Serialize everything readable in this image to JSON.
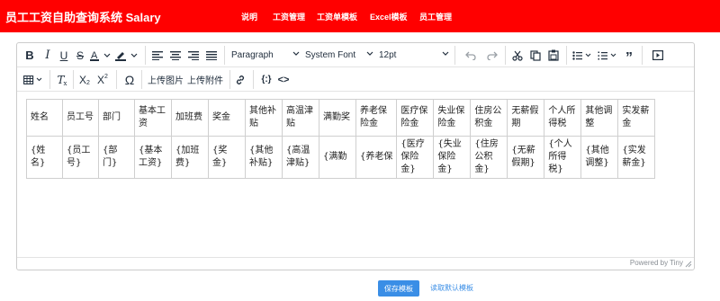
{
  "header": {
    "brand": "员工工资自助查询系统 Salary",
    "nav": [
      {
        "label": "说明"
      },
      {
        "label": "工资管理"
      },
      {
        "label": "工资单模板"
      },
      {
        "label": "Excel模板"
      },
      {
        "label": "员工管理"
      }
    ]
  },
  "toolbar": {
    "block_format": "Paragraph",
    "font_family": "System Font",
    "font_size": "12pt",
    "upload_image": "上传图片",
    "upload_attachment": "上传附件"
  },
  "table": {
    "headers": [
      "姓名",
      "员工号",
      "部门",
      "基本工资",
      "加班费",
      "奖金",
      "其他补贴",
      "高温津贴",
      "满勤奖",
      "养老保险金",
      "医疗保险金",
      "失业保险金",
      "住房公积金",
      "无薪假期",
      "个人所得税",
      "其他调整",
      "实发薪金"
    ],
    "cells": [
      "{姓名}",
      "{员工号}",
      "{部门}",
      "{基本工资}",
      "{加班费}",
      "{奖金}",
      "{其他补贴}",
      "{高温津贴}",
      "{满勤",
      "{养老保",
      "{医疗保险金}",
      "{失业保险金}",
      "{住房公积金}",
      "{无薪假期}",
      "{个人所得税}",
      "{其他调整}",
      "{实发薪金}"
    ]
  },
  "statusbar": {
    "powered_by": "Powered by Tiny"
  },
  "actions": {
    "save_label": "保存模板",
    "load_default_label": "读取默认模板"
  },
  "colors": {
    "header_bg": "#ff0000",
    "primary_button": "#3a8ee6"
  }
}
